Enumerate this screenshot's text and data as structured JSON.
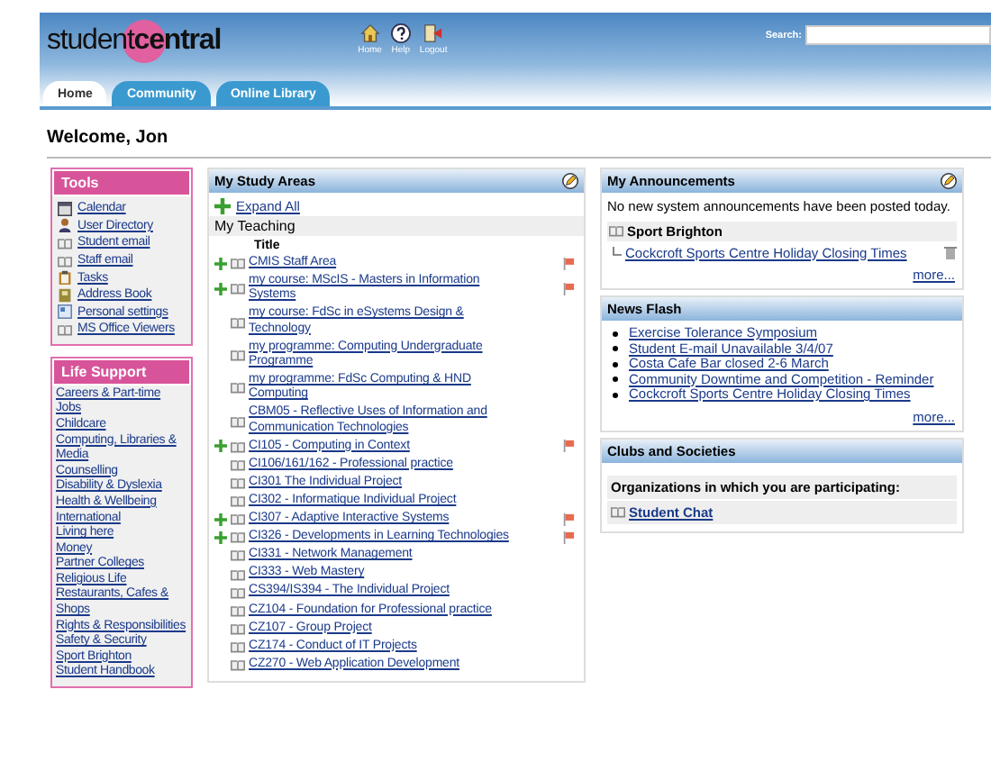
{
  "header": {
    "logo": {
      "light": "student",
      "bold": "central"
    },
    "nav": [
      {
        "label": "Home"
      },
      {
        "label": "Help"
      },
      {
        "label": "Logout"
      }
    ],
    "search": {
      "label": "Search:"
    }
  },
  "tabs": [
    {
      "label": "Home",
      "selected": true
    },
    {
      "label": "Community",
      "selected": false
    },
    {
      "label": "Online Library",
      "selected": false
    }
  ],
  "welcome": "Welcome, Jon",
  "tools": {
    "title": "Tools",
    "items": [
      "Calendar",
      "User Directory",
      "Student email",
      "Staff email",
      "Tasks",
      "Address Book",
      "Personal settings",
      "MS Office Viewers"
    ]
  },
  "life_support": {
    "title": "Life Support",
    "items": [
      "Careers & Part-time Jobs",
      "Childcare",
      "Computing, Libraries & Media",
      "Counselling",
      "Disability & Dyslexia",
      "Health & Wellbeing",
      "International",
      "Living here",
      "Money",
      "Partner Colleges",
      "Religious Life",
      "Restaurants, Cafes & Shops",
      "Rights & Responsibilities",
      "Safety & Security",
      "Sport Brighton",
      "Student Handbook"
    ]
  },
  "study_areas": {
    "title": "My Study Areas",
    "expand_all": "Expand All",
    "section": "My Teaching",
    "column": "Title",
    "items": [
      {
        "title": "CMIS Staff Area",
        "expandable": true,
        "flagged": true
      },
      {
        "title": "my course: MScIS - Masters in Information Systems",
        "expandable": true,
        "flagged": true
      },
      {
        "title": "my course: FdSc in eSystems Design & Technology",
        "expandable": false,
        "flagged": false
      },
      {
        "title": "my programme: Computing Undergraduate Programme",
        "expandable": false,
        "flagged": false
      },
      {
        "title": "my programme: FdSc Computing & HND Computing",
        "expandable": false,
        "flagged": false
      },
      {
        "title": "CBM05 - Reflective Uses of Information and Communication Technologies",
        "expandable": false,
        "flagged": false
      },
      {
        "title": "CI105 - Computing in Context",
        "expandable": true,
        "flagged": true
      },
      {
        "title": "CI106/161/162 - Professional practice",
        "expandable": false,
        "flagged": false
      },
      {
        "title": "CI301 The Individual Project",
        "expandable": false,
        "flagged": false
      },
      {
        "title": "CI302 - Informatique Individual Project",
        "expandable": false,
        "flagged": false
      },
      {
        "title": "CI307 - Adaptive Interactive Systems",
        "expandable": true,
        "flagged": true
      },
      {
        "title": "CI326 - Developments in Learning Technologies",
        "expandable": true,
        "flagged": true
      },
      {
        "title": "CI331 - Network Management",
        "expandable": false,
        "flagged": false
      },
      {
        "title": "CI333 - Web Mastery",
        "expandable": false,
        "flagged": false
      },
      {
        "title": "CS394/IS394 - The Individual Project",
        "expandable": false,
        "flagged": false
      },
      {
        "title": "CZ104 - Foundation for Professional practice",
        "expandable": false,
        "flagged": false
      },
      {
        "title": "CZ107 - Group Project",
        "expandable": false,
        "flagged": false
      },
      {
        "title": "CZ174 - Conduct of IT Projects",
        "expandable": false,
        "flagged": false
      },
      {
        "title": "CZ270 - Web Application Development",
        "expandable": false,
        "flagged": false
      }
    ]
  },
  "announcements": {
    "title": "My Announcements",
    "message": "No new system announcements have been posted today.",
    "group": "Sport Brighton",
    "items": [
      "Cockcroft Sports Centre Holiday Closing Times"
    ],
    "more": "more..."
  },
  "news_flash": {
    "title": "News Flash",
    "items": [
      "Exercise Tolerance Symposium",
      "Student E-mail Unavailable 3/4/07",
      "Costa Cafe Bar closed 2-6 March",
      "Community Downtime and Competition - Reminder",
      "Cockcroft Sports Centre Holiday Closing Times"
    ],
    "more": "more..."
  },
  "clubs": {
    "title": "Clubs and Societies",
    "heading": "Organizations in which you are participating:",
    "items": [
      "Student Chat"
    ]
  }
}
